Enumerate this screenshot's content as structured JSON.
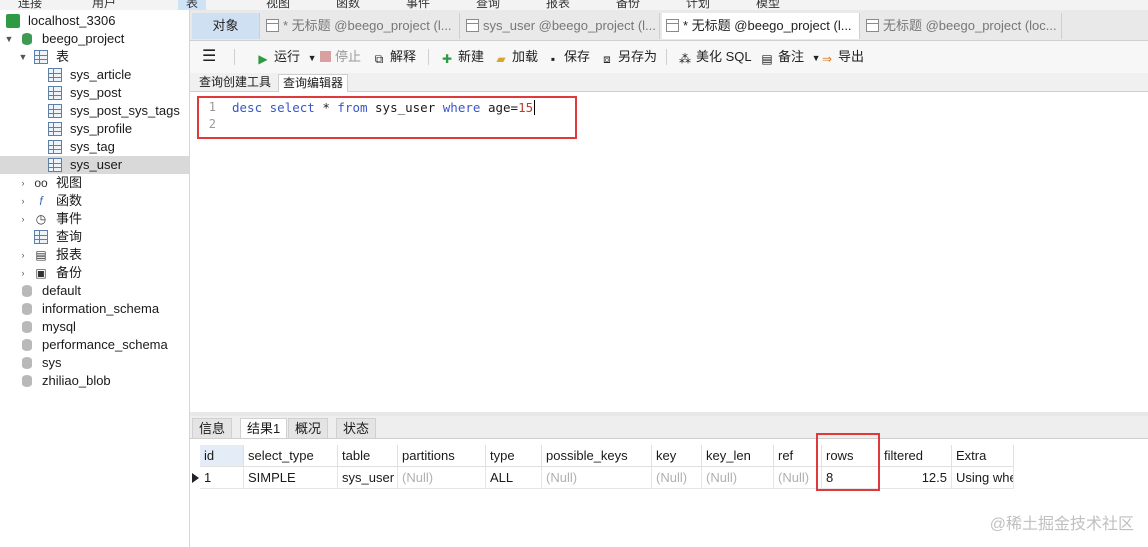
{
  "menubar": {
    "items": [
      "连接",
      "用户",
      "表",
      "视图",
      "函数",
      "事件",
      "查询",
      "报表",
      "备份",
      "计划",
      "模型"
    ]
  },
  "sidebar": {
    "connection": "localhost_3306",
    "database": "beego_project",
    "tables_group": "表",
    "tables": [
      "sys_article",
      "sys_post",
      "sys_post_sys_tags",
      "sys_profile",
      "sys_tag",
      "sys_user"
    ],
    "selected_table": "sys_user",
    "groups": [
      "视图",
      "函数",
      "事件",
      "查询",
      "报表",
      "备份"
    ],
    "other_databases": [
      "default",
      "information_schema",
      "mysql",
      "performance_schema",
      "sys",
      "zhiliao_blob"
    ]
  },
  "tabs": {
    "objects": "对象",
    "items": [
      "* 无标题 @beego_project (l...",
      "sys_user @beego_project (l...",
      "* 无标题 @beego_project (l...",
      "无标题 @beego_project (loc..."
    ]
  },
  "toolbar": {
    "run": "运行",
    "stop": "停止",
    "explain": "解释",
    "new": "新建",
    "load": "加载",
    "save": "保存",
    "save_as": "另存为",
    "beautify": "美化 SQL",
    "note": "备注",
    "export": "导出"
  },
  "subtabs": [
    "查询创建工具",
    "查询编辑器"
  ],
  "editor": {
    "lines": [
      "1",
      "2"
    ],
    "code": {
      "desc": "desc",
      "select": "select",
      "star": "*",
      "from": "from",
      "table": "sys_user",
      "where": "where",
      "cond": "age=",
      "value": "15"
    }
  },
  "result_tabs": [
    "信息",
    "结果1",
    "概况",
    "状态"
  ],
  "grid": {
    "columns": [
      "id",
      "select_type",
      "table",
      "partitions",
      "type",
      "possible_keys",
      "key",
      "key_len",
      "ref",
      "rows",
      "filtered",
      "Extra"
    ],
    "row": [
      "1",
      "SIMPLE",
      "sys_user",
      "(Null)",
      "ALL",
      "(Null)",
      "(Null)",
      "(Null)",
      "(Null)",
      "8",
      "12.5",
      "Using whe"
    ]
  },
  "watermark": "@稀土掘金技术社区",
  "colors": {
    "accent": "#cfe0f3",
    "highlight": "#e0393b",
    "keyword": "#3a56c8",
    "number": "#c0392b",
    "run_green": "#2f9a43"
  }
}
